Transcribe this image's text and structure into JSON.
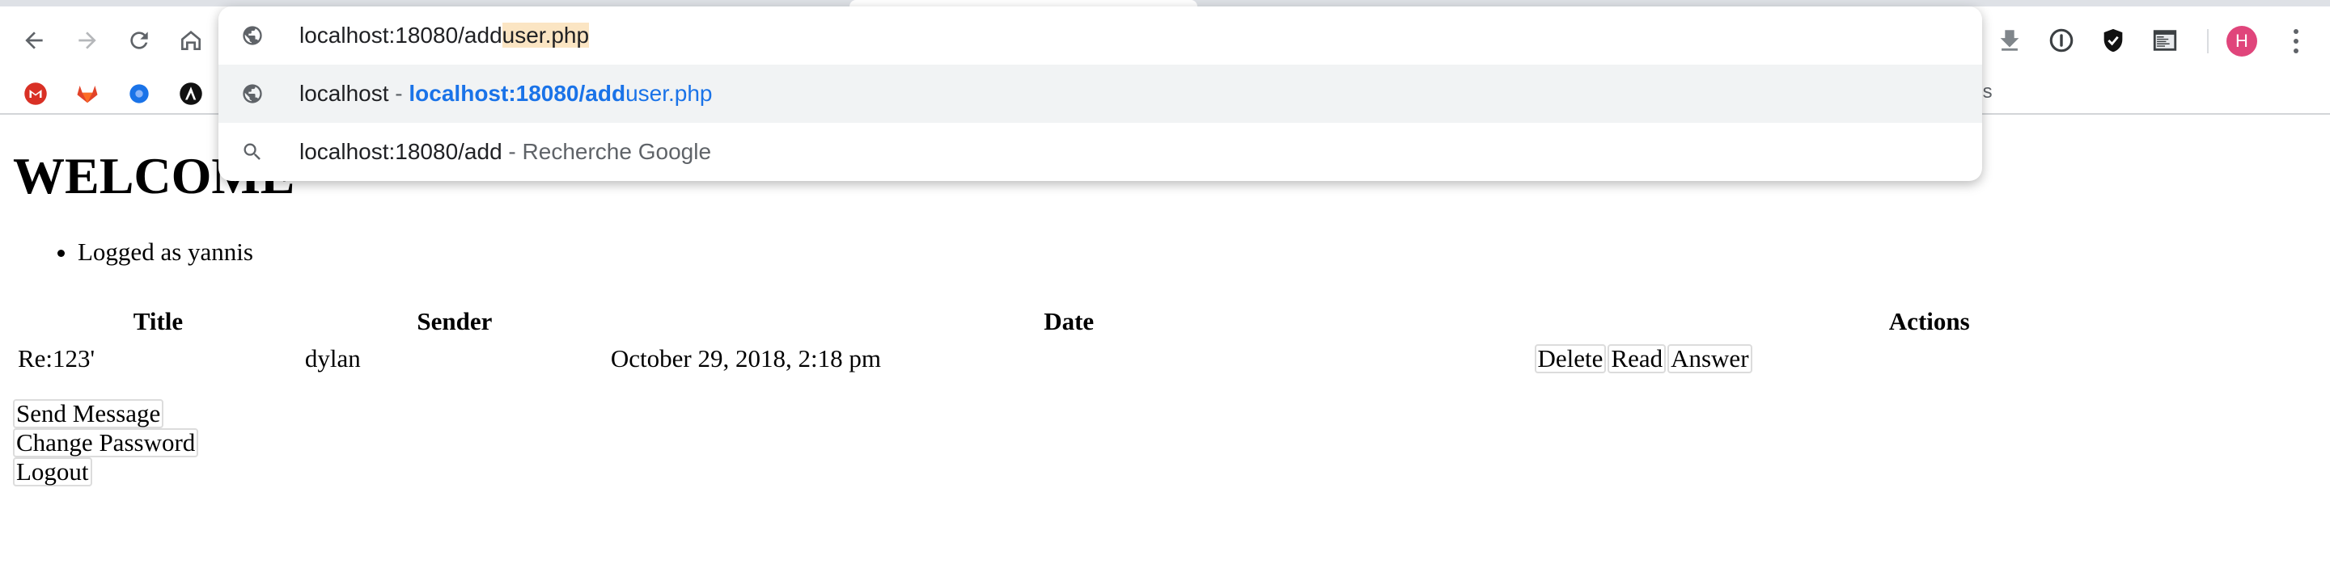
{
  "omnibox": {
    "input_typed": "localhost:18080/add",
    "input_autocomplete": "user.php",
    "suggestions": [
      {
        "kind": "history",
        "icon": "globe-icon",
        "title": "localhost",
        "separator": " - ",
        "url_match": "localhost:18080/add",
        "url_rest": "user.php"
      },
      {
        "kind": "search",
        "icon": "search-icon",
        "query": "localhost:18080/add",
        "separator": " - ",
        "engine_label": "Recherche Google"
      }
    ]
  },
  "toolbar": {
    "icons": [
      "back-icon",
      "forward-icon",
      "reload-icon",
      "home-icon"
    ],
    "extensions": [
      "download-icon",
      "password-icon",
      "shield-icon",
      "devtools-icon"
    ],
    "profile_initial": "H",
    "profile_color": "#e0457b"
  },
  "bookmarks": {
    "items": [
      "gmail-icon",
      "gitlab-icon",
      "chrome-web-icon",
      "ansible-icon"
    ],
    "tail_text": "ols"
  },
  "page": {
    "heading": "WELCOME",
    "user_info": [
      "Logged as yannis"
    ],
    "table": {
      "headers": [
        "Title",
        "Sender",
        "Date",
        "Actions"
      ],
      "rows": [
        {
          "title": "Re:123'",
          "sender": "dylan",
          "date": "October 29, 2018, 2:18 pm",
          "actions": [
            "Delete",
            "Read",
            "Answer"
          ]
        }
      ]
    },
    "links": [
      "Send Message",
      "Change Password",
      "Logout"
    ]
  },
  "colors": {
    "accent_blue": "#1a73e8",
    "autocomplete_highlight": "#fbe5c3",
    "selected_row": "#f1f3f4"
  }
}
